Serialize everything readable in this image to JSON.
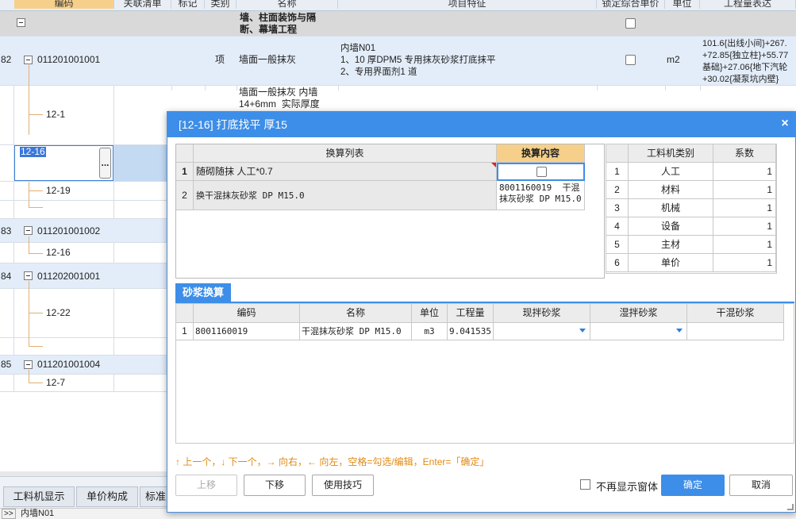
{
  "grid": {
    "headers": [
      {
        "text": "编码"
      },
      {
        "text": "关联清单"
      },
      {
        "text": "标记"
      },
      {
        "text": "类别"
      },
      {
        "text": "名称"
      },
      {
        "text": "项目特征"
      },
      {
        "text": "锁定综合单价"
      },
      {
        "text": "单位"
      },
      {
        "text": "工程量表达"
      }
    ],
    "section_title": "墙、柱面装饰与隔\n断、幕墙工程",
    "row82": {
      "num": "82",
      "code": "011201001001",
      "type": "项",
      "name": "墙面一般抹灰",
      "feature": "内墙N01\n1、10 厚DPM5 专用抹灰砂浆打底抹平\n2、专用界面剂1 道",
      "unit": "m2",
      "expr": "101.6{出线小间}+267.\n+72.85{独立柱}+55.77\n基础}+27.06{地下汽轮\n+30.02{凝泵坑内壁}"
    },
    "sub_12_1": {
      "code": "12-1",
      "name": "墙面一般抹灰 内墙\n14+6mm  实际厚度"
    },
    "editing_cell": {
      "value": "12-16",
      "dots": "..."
    },
    "sub_12_19": {
      "code": "12-19"
    },
    "row83": {
      "num": "83",
      "code": "011201001002"
    },
    "sub_12_16": {
      "code": "12-16"
    },
    "row84": {
      "num": "84",
      "code": "011202001001"
    },
    "sub_12_22": {
      "code": "12-22"
    },
    "row85": {
      "num": "85",
      "code": "011201001004"
    },
    "sub_12_7": {
      "code": "12-7"
    },
    "bottom_tabs": [
      "工料机显示",
      "单价构成",
      "标准"
    ],
    "status_text": "内墙N01",
    "status_arrows": ">>"
  },
  "dialog": {
    "title": "[12-16] 打底找平 厚15",
    "close_label": "×",
    "conversion": {
      "header_list": "换算列表",
      "header_content": "换算内容",
      "rows": [
        {
          "num": "1",
          "item": "随砌随抹 人工*0.7",
          "content": ""
        },
        {
          "num": "2",
          "item": "换干混抹灰砂浆 DP M15.0",
          "content": "8001160019  干混\n抹灰砂浆 DP M15.0"
        }
      ]
    },
    "coeff": {
      "header_type": "工料机类别",
      "header_coef": "系数",
      "rows": [
        {
          "num": "1",
          "type": "人工",
          "coef": "1"
        },
        {
          "num": "2",
          "type": "材料",
          "coef": "1"
        },
        {
          "num": "3",
          "type": "机械",
          "coef": "1"
        },
        {
          "num": "4",
          "type": "设备",
          "coef": "1"
        },
        {
          "num": "5",
          "type": "主材",
          "coef": "1"
        },
        {
          "num": "6",
          "type": "单价",
          "coef": "1"
        }
      ]
    },
    "mortar": {
      "tab_label": "砂浆换算",
      "headers": {
        "code": "编码",
        "name": "名称",
        "unit": "单位",
        "qty": "工程量",
        "site": "现拌砂浆",
        "wet": "湿拌砂浆",
        "dry": "干混砂浆"
      },
      "row": {
        "num": "1",
        "code": "8001160019",
        "name": "干混抹灰砂浆 DP M15.0",
        "unit": "m3",
        "qty": "9.041535",
        "site": "",
        "wet": "",
        "dry": ""
      }
    },
    "hint": "↑ 上一个，↓ 下一个，→ 向右，← 向左，空格=勾选/编辑，Enter=「确定」",
    "buttons": {
      "up": "上移",
      "down": "下移",
      "tips": "使用技巧",
      "ok": "确定",
      "cancel": "取消"
    },
    "no_show_label": "不再显示窗体"
  }
}
